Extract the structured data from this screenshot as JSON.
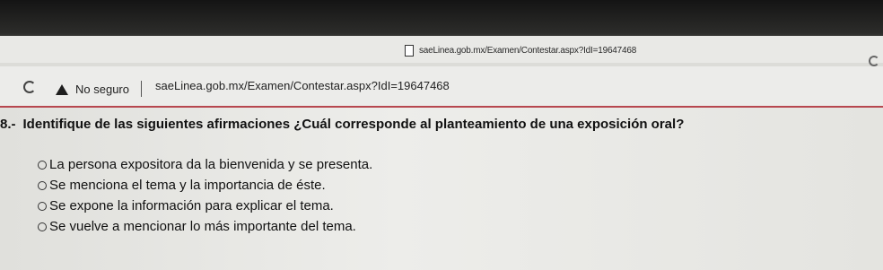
{
  "tooltip": {
    "url": "saeLinea.gob.mx/Examen/Contestar.aspx?IdI=19647468"
  },
  "addressbar": {
    "security_label": "No seguro",
    "url": "saeLinea.gob.mx/Examen/Contestar.aspx?IdI=19647468"
  },
  "question": {
    "number": "8.-",
    "text": "Identifique de las siguientes afirmaciones ¿Cuál corresponde al planteamiento de una exposición oral?"
  },
  "options": [
    {
      "label": "La persona expositora da la bienvenida y se presenta."
    },
    {
      "label": "Se menciona el tema y la importancia de éste."
    },
    {
      "label": "Se expone la información para explicar el tema."
    },
    {
      "label": "Se vuelve a mencionar lo más importante del tema."
    }
  ]
}
